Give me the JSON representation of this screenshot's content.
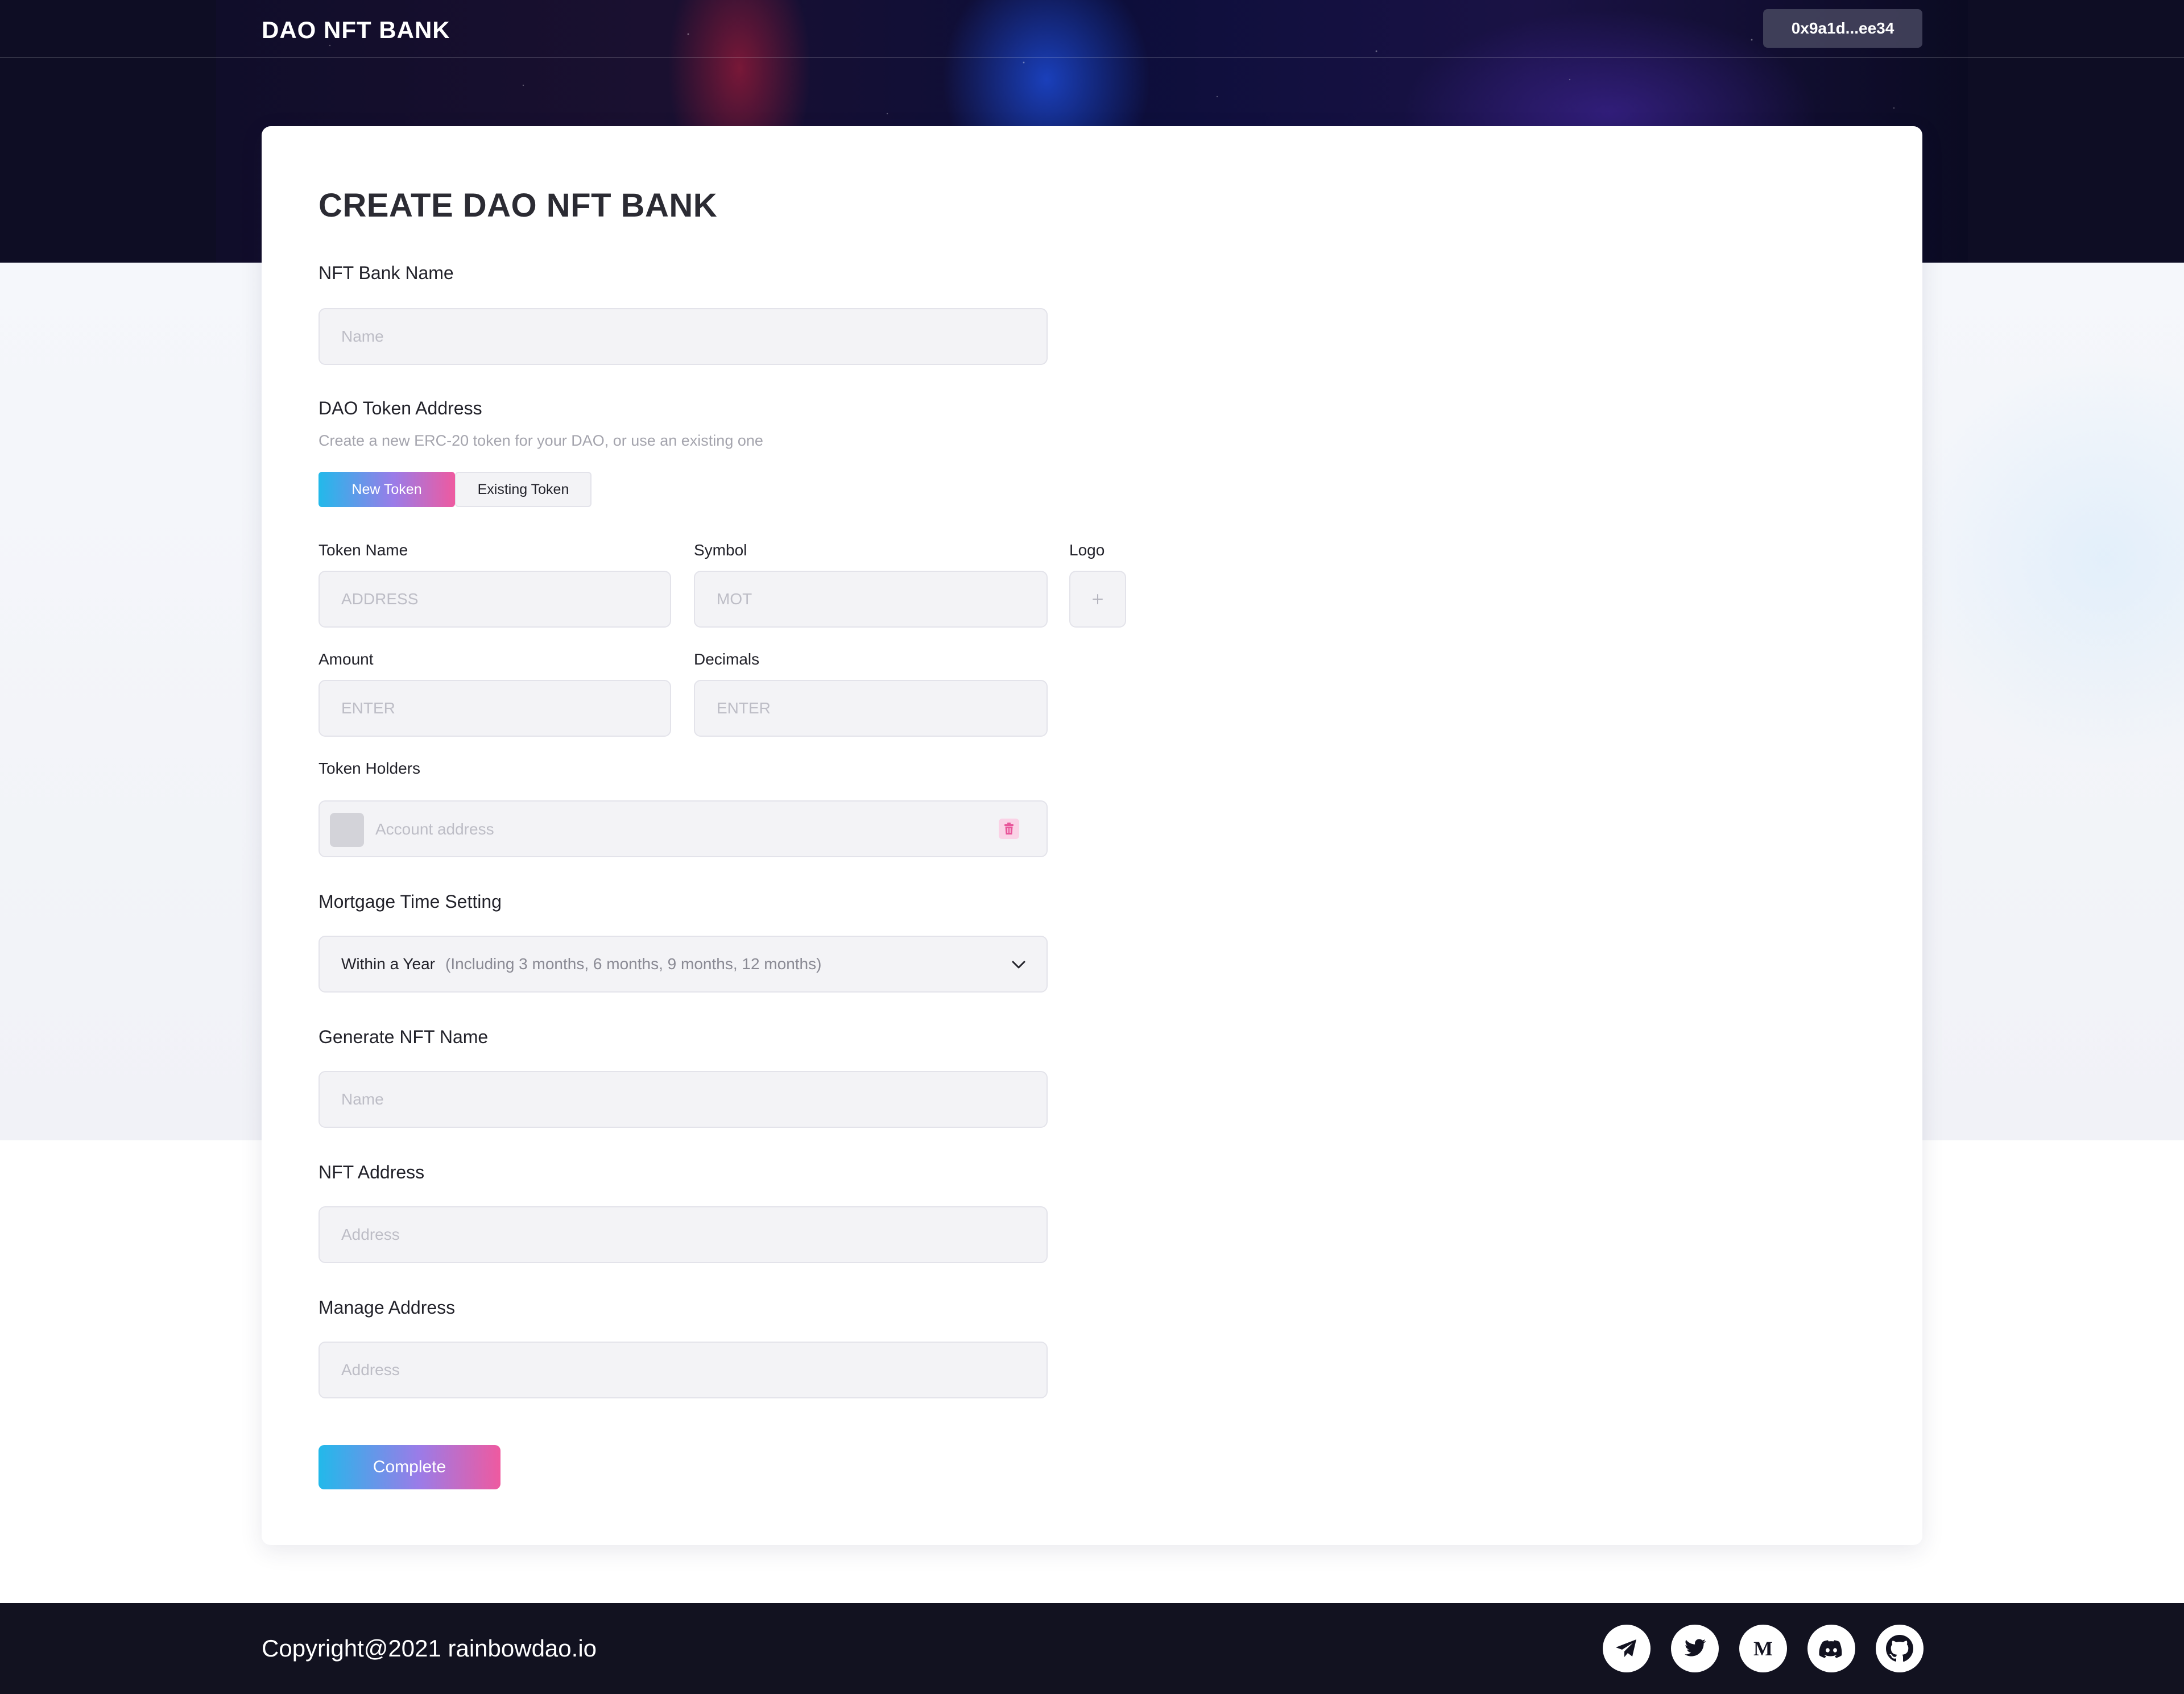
{
  "header": {
    "brand": "DAO NFT BANK",
    "wallet_address": "0x9a1d...ee34"
  },
  "form": {
    "title": "CREATE DAO NFT BANK",
    "bank_name": {
      "label": "NFT Bank Name",
      "placeholder": "Name"
    },
    "dao_token": {
      "label": "DAO Token Address",
      "hint": "Create a new ERC-20 token for your DAO, or use an existing one",
      "toggle_new": "New Token",
      "toggle_existing": "Existing Token",
      "selected": "New Token"
    },
    "token_name": {
      "label": "Token Name",
      "placeholder": "ADDRESS"
    },
    "symbol": {
      "label": "Symbol",
      "placeholder": "MOT"
    },
    "logo": {
      "label": "Logo",
      "icon": "plus-icon"
    },
    "amount": {
      "label": "Amount",
      "placeholder": "ENTER"
    },
    "decimals": {
      "label": "Decimals",
      "placeholder": "ENTER"
    },
    "token_holders": {
      "label": "Token Holders",
      "placeholder": "Account address",
      "delete_icon": "trash-icon"
    },
    "mortgage_time": {
      "label": "Mortgage Time Setting",
      "value": "Within a Year",
      "note": "(Including 3 months, 6 months, 9 months, 12 months)"
    },
    "nft_name": {
      "label": "Generate NFT Name",
      "placeholder": "Name"
    },
    "nft_address": {
      "label": "NFT Address",
      "placeholder": "Address"
    },
    "manage_address": {
      "label": "Manage Address",
      "placeholder": "Address"
    },
    "submit_label": "Complete"
  },
  "footer": {
    "copyright": "Copyright@2021 rainbowdao.io",
    "social_icons": [
      "telegram-icon",
      "twitter-icon",
      "medium-icon",
      "discord-icon",
      "github-icon"
    ]
  },
  "colors": {
    "accent_gradient_start": "#22b9ea",
    "accent_gradient_mid": "#9a7ce8",
    "accent_gradient_end": "#ee5aa0",
    "header_bg": "#0e0d24",
    "footer_bg": "#121220",
    "delete_pink": "#e8559a"
  }
}
